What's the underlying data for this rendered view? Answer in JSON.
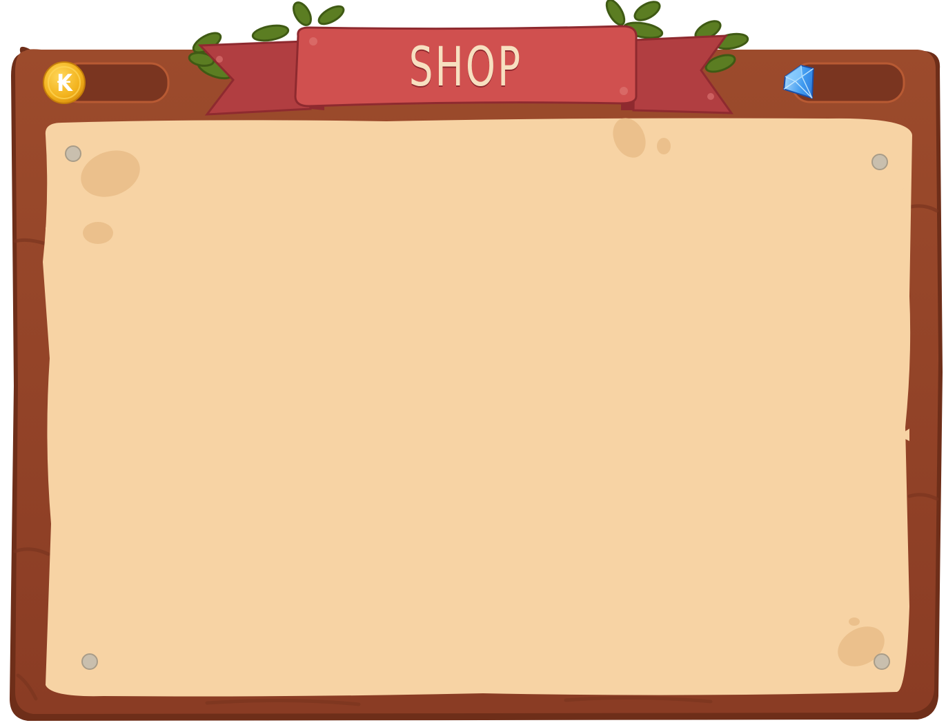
{
  "window": {
    "title": "SHOP"
  },
  "currencies": {
    "coin": {
      "icon": "coin-icon",
      "symbol": "₭",
      "value": ""
    },
    "gem": {
      "icon": "diamond-icon",
      "value": ""
    }
  },
  "colors": {
    "wood_dark": "#7a3520",
    "wood": "#9a4629",
    "wood_light": "#b25a33",
    "parchment": "#f7d3a4",
    "banner": "#d0504f",
    "banner_dark": "#b13e41",
    "leaf": "#5b7d22",
    "pin": "#c9bfae",
    "coin": "#f2b21c",
    "gem": "#4fa6f0"
  },
  "content": {
    "items": []
  }
}
